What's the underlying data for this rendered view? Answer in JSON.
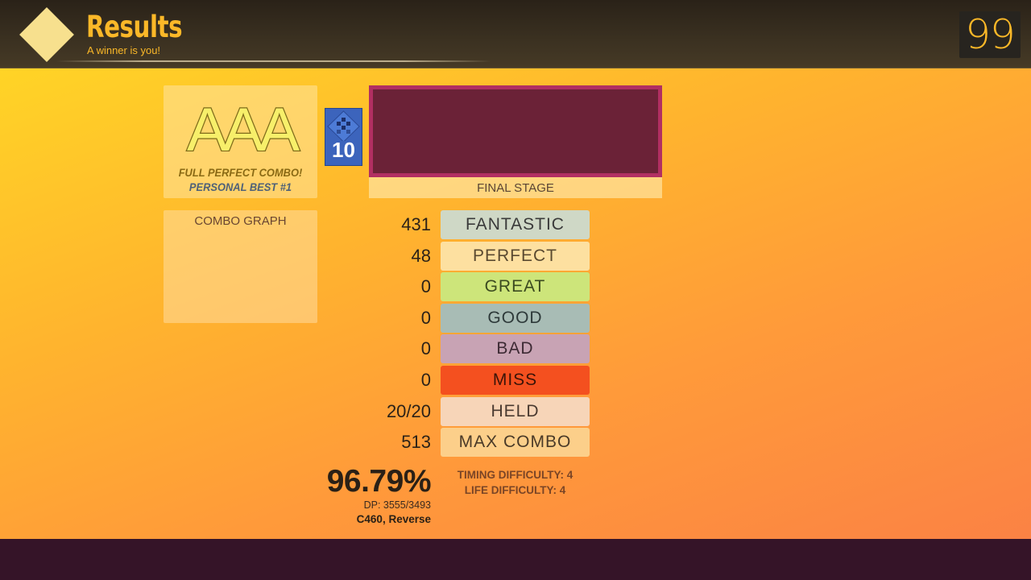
{
  "header": {
    "title": "Results",
    "subtitle": "A winner is you!",
    "timer": "99"
  },
  "grade": {
    "letters": "AAA",
    "line1": "FULL PERFECT COMBO!",
    "line2": "PERSONAL BEST #1"
  },
  "song": {
    "meter": "10",
    "stage_label": "FINAL STAGE"
  },
  "combo_graph": {
    "title": "COMBO GRAPH"
  },
  "judgments": [
    {
      "label": "FANTASTIC",
      "count": "431",
      "color": "#cfd8c6",
      "text_color": "#3a3a3a"
    },
    {
      "label": "PERFECT",
      "count": "48",
      "color": "#fde0a0",
      "text_color": "#5a4a30"
    },
    {
      "label": "GREAT",
      "count": "0",
      "color": "#cde57a",
      "text_color": "#3b4a20"
    },
    {
      "label": "GOOD",
      "count": "0",
      "color": "#a8bcb5",
      "text_color": "#2e3a3a"
    },
    {
      "label": "BAD",
      "count": "0",
      "color": "#c8a3b4",
      "text_color": "#3d2a34"
    },
    {
      "label": "MISS",
      "count": "0",
      "color": "#f4501f",
      "text_color": "#3a1408"
    },
    {
      "label": "HELD",
      "count": "20/20",
      "color": "#f7d5b8",
      "text_color": "#4a3a30"
    },
    {
      "label": "MAX COMBO",
      "count": "513",
      "color": "#fccf8a",
      "text_color": "#4a3a28"
    }
  ],
  "score": {
    "percent": "96.79%",
    "dp": "DP: 3555/3493",
    "mods": "C460, Reverse"
  },
  "difficulty": {
    "timing": "TIMING DIFFICULTY: 4",
    "life": "LIFE DIFFICULTY: 4"
  }
}
